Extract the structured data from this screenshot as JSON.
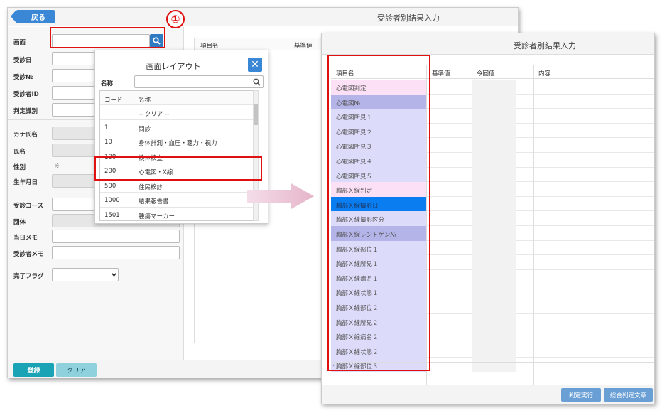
{
  "win1": {
    "back_label": "戻る",
    "title": "受診者別結果入力",
    "fields": {
      "screen": "画面",
      "date": "受診日",
      "no": "受診№",
      "id": "受診者ID",
      "judge": "判定識別",
      "kana": "カナ氏名",
      "name": "氏名",
      "sex": "性別",
      "sex_value": "※",
      "birth": "生年月日",
      "course": "受診コース",
      "group": "団体",
      "memo_day": "当日メモ",
      "memo_person": "受診者メモ",
      "done": "完了フラグ"
    },
    "grid_headers": [
      "項目名",
      "基準値"
    ],
    "register_label": "登録",
    "clear_label": "クリア"
  },
  "annotation": "①",
  "popup": {
    "title": "画面レイアウト",
    "close": "✕",
    "search_label": "名称",
    "col_code": "コード",
    "col_name": "名称",
    "rows": [
      {
        "code": "",
        "name": "-- クリア --"
      },
      {
        "code": "1",
        "name": "問診"
      },
      {
        "code": "10",
        "name": "身体計測・血圧・聴力・視力"
      },
      {
        "code": "100",
        "name": "検体検査"
      },
      {
        "code": "200",
        "name": "心電図・X線"
      },
      {
        "code": "500",
        "name": "住民検診"
      },
      {
        "code": "1000",
        "name": "結果報告書"
      },
      {
        "code": "1501",
        "name": "腫瘍マーカー"
      }
    ]
  },
  "win2": {
    "title": "受診者別結果入力",
    "headers": [
      "項目名",
      "基準値",
      "今回値",
      "内容"
    ],
    "rows": [
      {
        "name": "心電図判定",
        "bg": "#fce0f5"
      },
      {
        "name": "心電図№",
        "bg": "#b4b4e8"
      },
      {
        "name": "心電図所見１",
        "bg": "#dcdcfa"
      },
      {
        "name": "心電図所見２",
        "bg": "#dcdcfa"
      },
      {
        "name": "心電図所見３",
        "bg": "#dcdcfa"
      },
      {
        "name": "心電図所見４",
        "bg": "#dcdcfa"
      },
      {
        "name": "心電図所見５",
        "bg": "#dcdcfa"
      },
      {
        "name": "胸部Ｘ線判定",
        "bg": "#fce0f5"
      },
      {
        "name": "胸部Ｘ線撮影日",
        "bg": "#0a7df0"
      },
      {
        "name": "胸部Ｘ線撮影区分",
        "bg": "#dcdcfa"
      },
      {
        "name": "胸部Ｘ線レントゲン№",
        "bg": "#b4b4e8"
      },
      {
        "name": "胸部Ｘ線部位１",
        "bg": "#dcdcfa"
      },
      {
        "name": "胸部Ｘ線所見１",
        "bg": "#dcdcfa"
      },
      {
        "name": "胸部Ｘ線病名１",
        "bg": "#dcdcfa"
      },
      {
        "name": "胸部Ｘ線状態１",
        "bg": "#dcdcfa"
      },
      {
        "name": "胸部Ｘ線部位２",
        "bg": "#dcdcfa"
      },
      {
        "name": "胸部Ｘ線所見２",
        "bg": "#dcdcfa"
      },
      {
        "name": "胸部Ｘ線病名２",
        "bg": "#dcdcfa"
      },
      {
        "name": "胸部Ｘ線状態２",
        "bg": "#dcdcfa"
      },
      {
        "name": "胸部Ｘ線部位３",
        "bg": "#dcdcfa"
      }
    ],
    "btn_judge": "判定実行",
    "btn_overall": "総合判定文章"
  }
}
